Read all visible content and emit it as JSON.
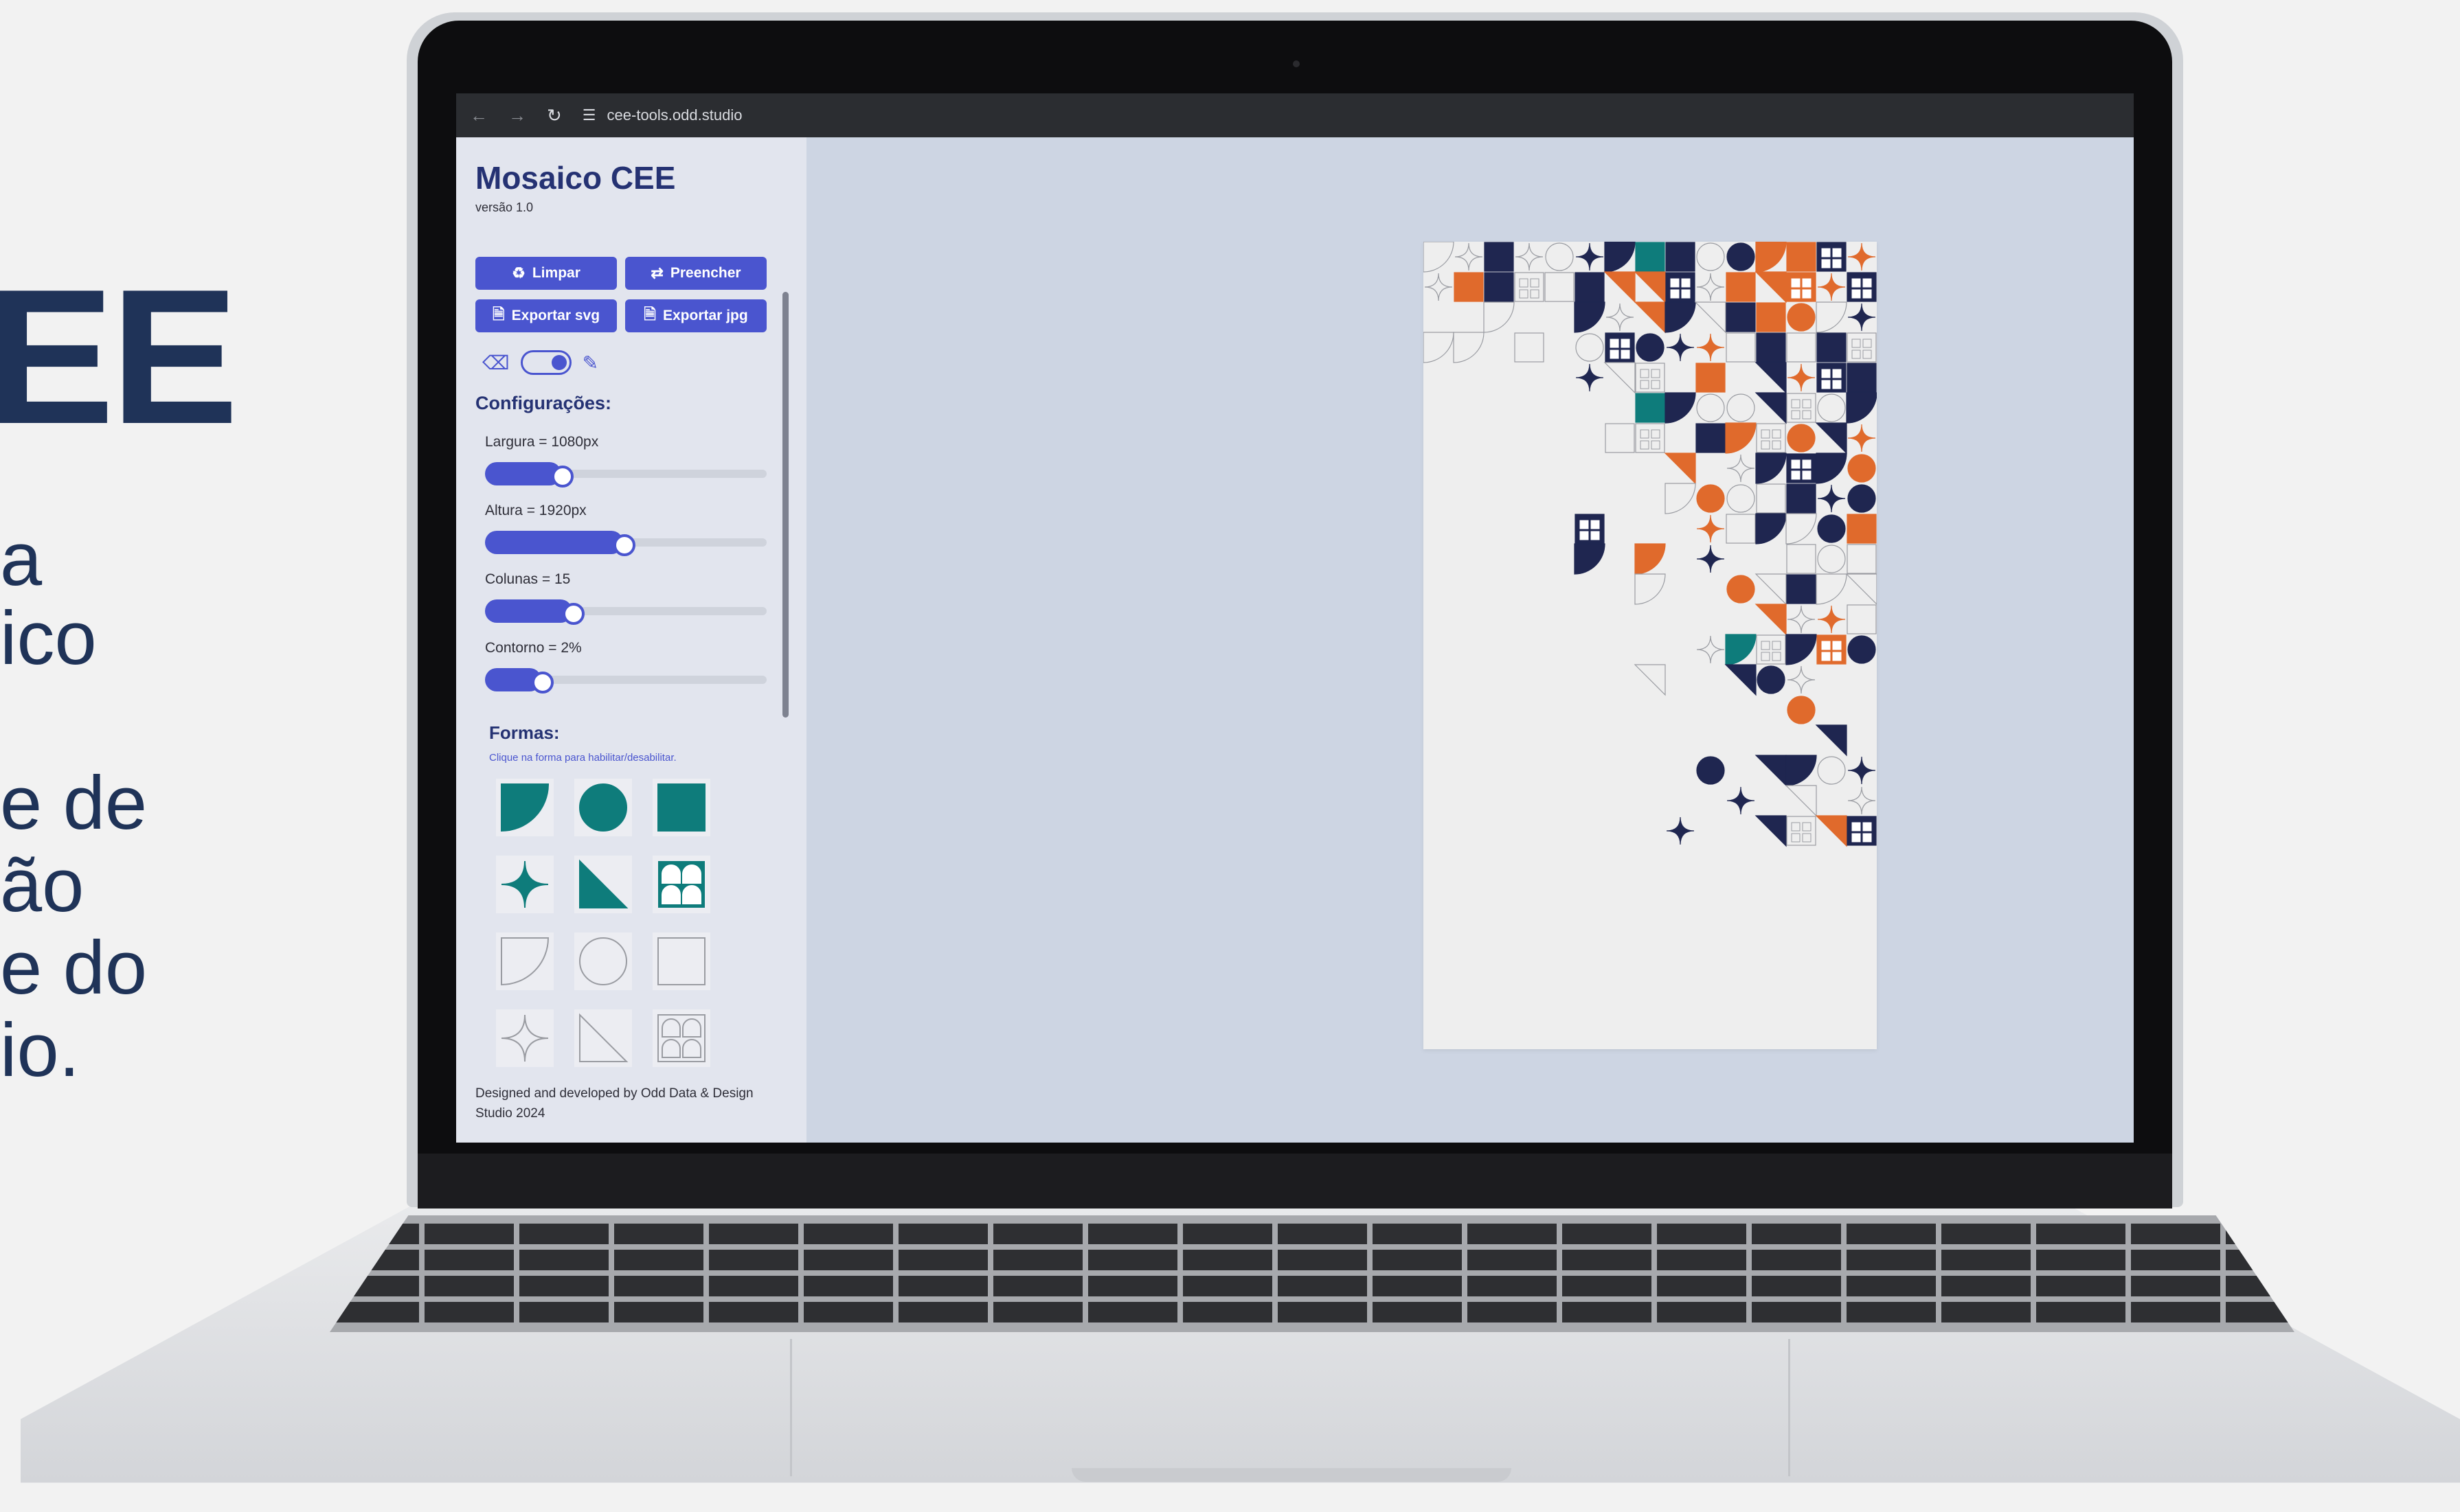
{
  "hero": {
    "title_fragment": "EE",
    "lines": [
      "a",
      "ico",
      "e de",
      "ão",
      "e do",
      "io."
    ]
  },
  "browser": {
    "url": "cee-tools.odd.studio",
    "nav_icons": [
      "back-icon",
      "forward-icon",
      "reload-icon",
      "site-settings-icon"
    ]
  },
  "sidebar": {
    "title": "Mosaico CEE",
    "version": "versão 1.0",
    "buttons": {
      "clear": "Limpar",
      "fill": "Preencher",
      "export_svg": "Exportar svg",
      "export_jpg": "Exportar jpg"
    },
    "mode_toggle": {
      "left_icon": "eraser-icon",
      "right_icon": "pencil-icon",
      "selected": "pencil"
    },
    "settings_heading": "Configurações:",
    "sliders": [
      {
        "label": "Largura = 1080px",
        "fraction": 0.27
      },
      {
        "label": "Altura = 1920px",
        "fraction": 0.49
      },
      {
        "label": "Colunas = 15",
        "fraction": 0.31
      },
      {
        "label": "Contorno = 2%",
        "fraction": 0.2
      }
    ],
    "shapes_heading": "Formas:",
    "shapes_hint": "Clique na forma para habilitar/desabilitar.",
    "shapes": [
      {
        "name": "quarter-circle",
        "enabled": true
      },
      {
        "name": "circle",
        "enabled": true
      },
      {
        "name": "square",
        "enabled": true
      },
      {
        "name": "star",
        "enabled": true
      },
      {
        "name": "triangle",
        "enabled": true
      },
      {
        "name": "windows",
        "enabled": true
      },
      {
        "name": "quarter-circle",
        "enabled": false
      },
      {
        "name": "circle",
        "enabled": false
      },
      {
        "name": "square",
        "enabled": false
      },
      {
        "name": "star",
        "enabled": false
      },
      {
        "name": "triangle",
        "enabled": false
      },
      {
        "name": "windows",
        "enabled": false
      }
    ],
    "footer": "Designed and developed by Odd Data & Design Studio 2024"
  },
  "colors": {
    "accent": "#4a55cf",
    "title": "#253273",
    "teal": "#0e7c7b",
    "navy": "#1f2650",
    "orange": "#e06a2c",
    "outline": "#9a9ca2"
  }
}
